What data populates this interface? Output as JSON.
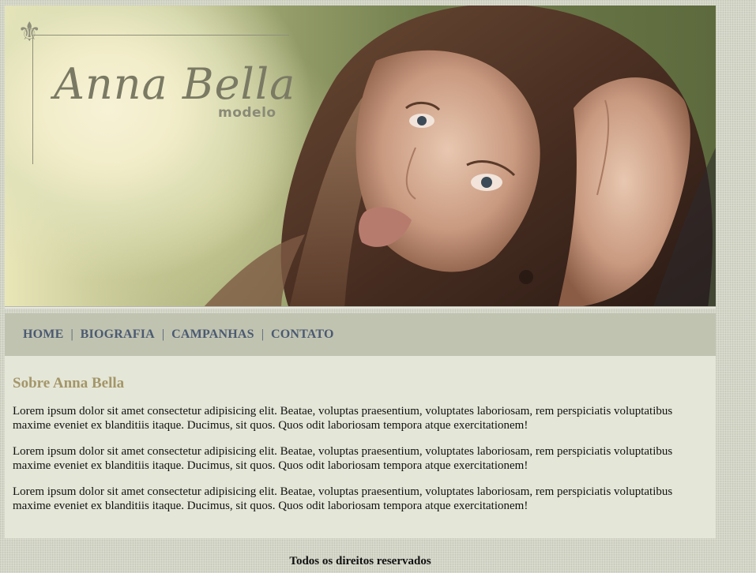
{
  "header": {
    "brand_name": "Anna Bella",
    "brand_subtitle": "modelo",
    "ornament_icon": "fleur-de-lis-icon"
  },
  "nav": {
    "items": [
      {
        "label": "HOME"
      },
      {
        "label": "BIOGRAFIA"
      },
      {
        "label": "CAMPANHAS"
      },
      {
        "label": "CONTATO"
      }
    ],
    "separator": "|"
  },
  "main": {
    "title": "Sobre Anna Bella",
    "paragraphs": [
      "Lorem ipsum dolor sit amet consectetur adipisicing elit. Beatae, voluptas praesentium, voluptates laboriosam, rem perspiciatis voluptatibus maxime eveniet ex blanditiis itaque. Ducimus, sit quos. Quos odit laboriosam tempora atque exercitationem!",
      "Lorem ipsum dolor sit amet consectetur adipisicing elit. Beatae, voluptas praesentium, voluptates laboriosam, rem perspiciatis voluptatibus maxime eveniet ex blanditiis itaque. Ducimus, sit quos. Quos odit laboriosam tempora atque exercitationem!",
      "Lorem ipsum dolor sit amet consectetur adipisicing elit. Beatae, voluptas praesentium, voluptates laboriosam, rem perspiciatis voluptatibus maxime eveniet ex blanditiis itaque. Ducimus, sit quos. Quos odit laboriosam tempora atque exercitationem!"
    ]
  },
  "footer": {
    "text": "Todos os direitos reservados"
  },
  "colors": {
    "nav_link": "#4b5a72",
    "title": "#a4966a",
    "content_bg": "#e4e6d7",
    "nav_bg": "#c0c3b0"
  }
}
